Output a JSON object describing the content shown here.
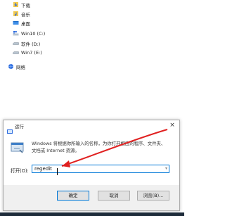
{
  "nav": {
    "items": [
      {
        "label": "下载",
        "icon": "download-icon"
      },
      {
        "label": "音乐",
        "icon": "music-icon"
      },
      {
        "label": "桌面",
        "icon": "desktop-icon"
      },
      {
        "label": "Win10 (C:)",
        "icon": "windows-drive-icon"
      },
      {
        "label": "软件 (D:)",
        "icon": "drive-icon"
      },
      {
        "label": "Win7 (E:)",
        "icon": "drive-icon"
      },
      {
        "label": "网络",
        "icon": "network-icon"
      }
    ]
  },
  "dialog": {
    "title": "运行",
    "close_label": "×",
    "description": "Windows 将根据你所输入的名称，为你打开相应的程序、文件夹、文档或 Internet 资源。",
    "open_label": "打开(O):",
    "open_value": "regedit",
    "buttons": {
      "ok": "确定",
      "cancel": "取消",
      "browse": "浏览(B)..."
    }
  },
  "colors": {
    "accent": "#0078d7",
    "annotation_arrow": "#e02020"
  }
}
